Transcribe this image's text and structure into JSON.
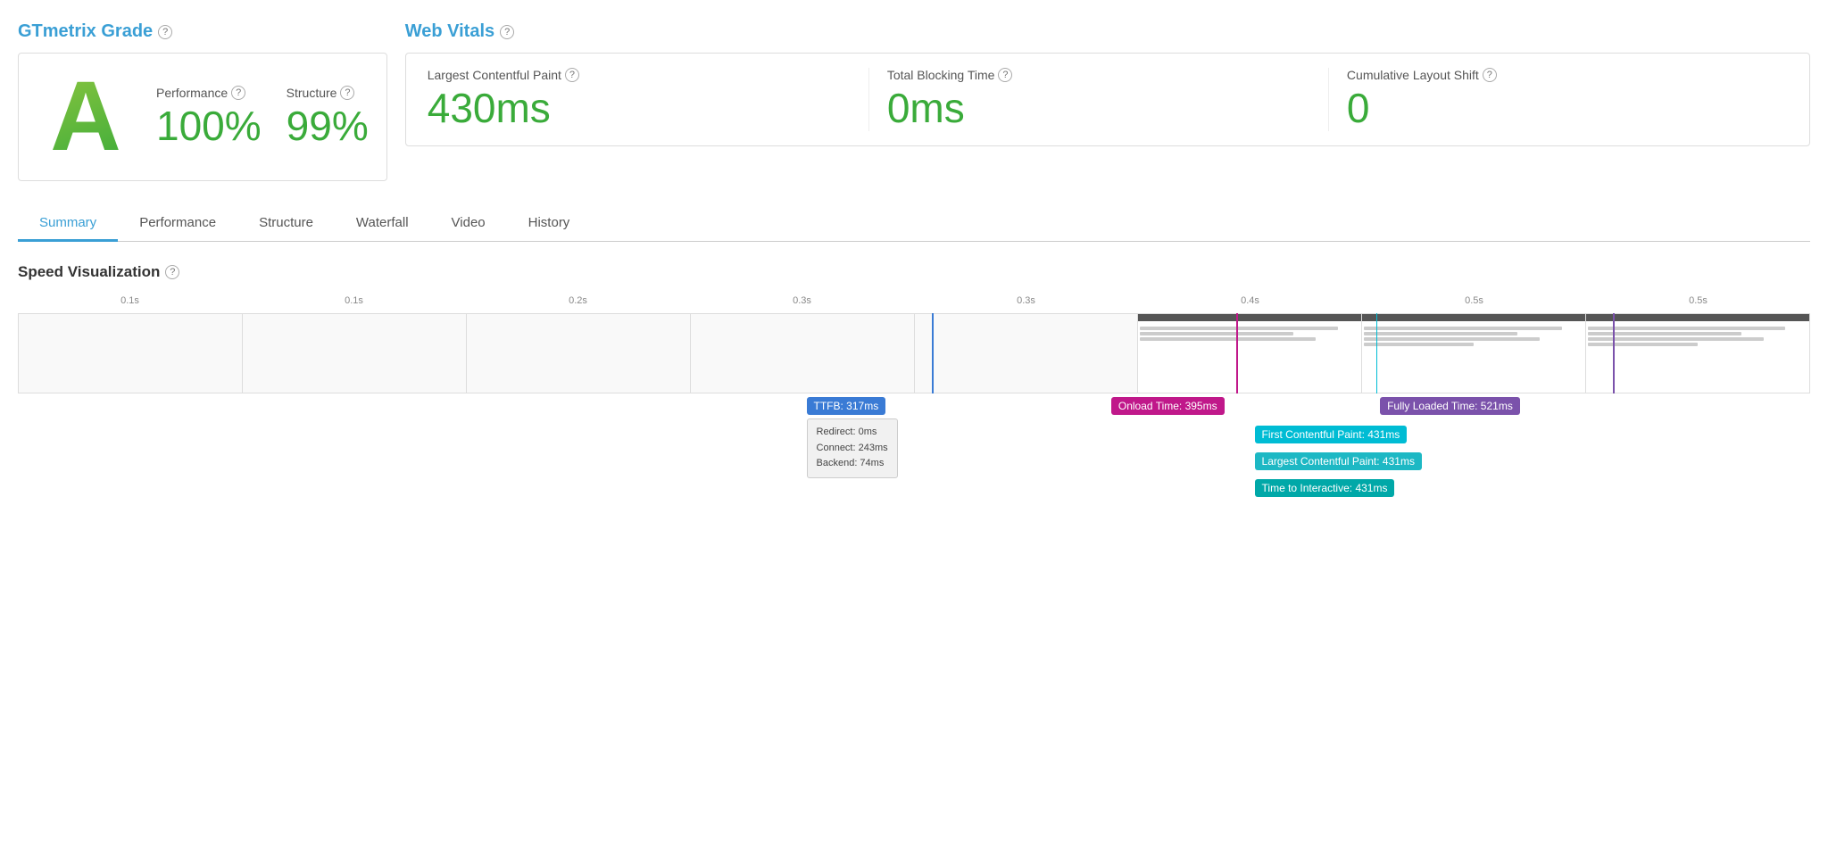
{
  "grade_section": {
    "title": "GTmetrix Grade",
    "help": "?",
    "letter": "A",
    "performance_label": "Performance",
    "performance_value": "100%",
    "structure_label": "Structure",
    "structure_value": "99%"
  },
  "web_vitals": {
    "title": "Web Vitals",
    "help": "?",
    "lcp_label": "Largest Contentful Paint",
    "lcp_value": "430ms",
    "tbt_label": "Total Blocking Time",
    "tbt_value": "0ms",
    "cls_label": "Cumulative Layout Shift",
    "cls_value": "0"
  },
  "tabs": [
    {
      "id": "summary",
      "label": "Summary",
      "active": true
    },
    {
      "id": "performance",
      "label": "Performance",
      "active": false
    },
    {
      "id": "structure",
      "label": "Structure",
      "active": false
    },
    {
      "id": "waterfall",
      "label": "Waterfall",
      "active": false
    },
    {
      "id": "video",
      "label": "Video",
      "active": false
    },
    {
      "id": "history",
      "label": "History",
      "active": false
    }
  ],
  "speed_viz": {
    "title": "Speed Visualization",
    "help": "?",
    "ruler_ticks": [
      "0.1s",
      "0.1s",
      "0.2s",
      "0.3s",
      "0.3s",
      "0.4s",
      "0.5s",
      "0.5s"
    ],
    "annotations": {
      "ttfb": {
        "label": "TTFB: 317ms",
        "tooltip": "Redirect: 0ms\nConnect: 243ms\nBackend: 74ms"
      },
      "onload": {
        "label": "Onload Time: 395ms"
      },
      "fully_loaded": {
        "label": "Fully Loaded Time: 521ms"
      },
      "fcp": {
        "label": "First Contentful Paint: 431ms"
      },
      "lcp": {
        "label": "Largest Contentful Paint: 431ms"
      },
      "tti": {
        "label": "Time to Interactive: 431ms"
      }
    }
  }
}
